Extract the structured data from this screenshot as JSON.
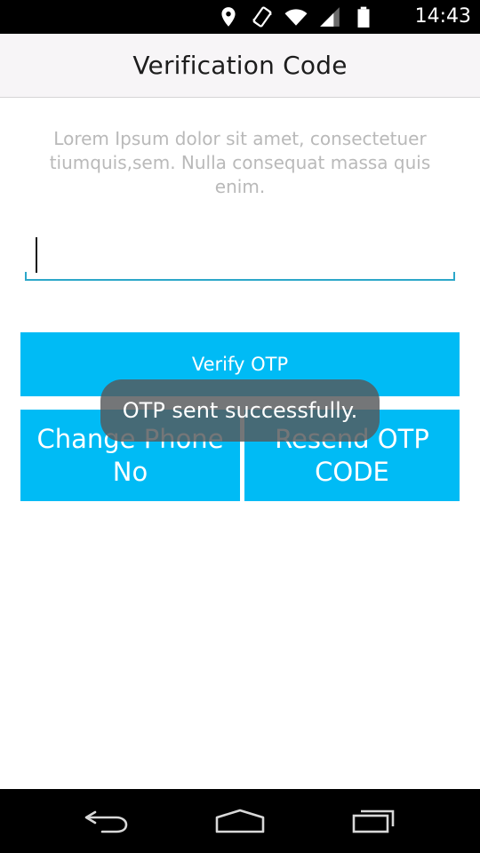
{
  "status_bar": {
    "time": "14:43",
    "icons": [
      "location-icon",
      "rotation-icon",
      "wifi-icon",
      "signal-icon",
      "battery-icon"
    ]
  },
  "app_bar": {
    "title": "Verification Code"
  },
  "description": "Lorem Ipsum dolor sit amet, consectetuer tiumquis,sem. Nulla consequat massa quis enim.",
  "otp_input": {
    "value": "",
    "placeholder": ""
  },
  "buttons": {
    "verify": "Verify OTP",
    "change_phone": "Change Phone No",
    "resend": "Resend OTP CODE"
  },
  "toast": {
    "message": "OTP sent successfully."
  },
  "nav_bar": {
    "icons": [
      "back-icon",
      "home-icon",
      "recents-icon"
    ]
  },
  "colors": {
    "accent": "#00bbf5",
    "input_underline": "#2da7c9",
    "app_bar_bg": "#f7f5f7",
    "description_text": "#b9b9b9",
    "toast_bg": "#55585a"
  }
}
